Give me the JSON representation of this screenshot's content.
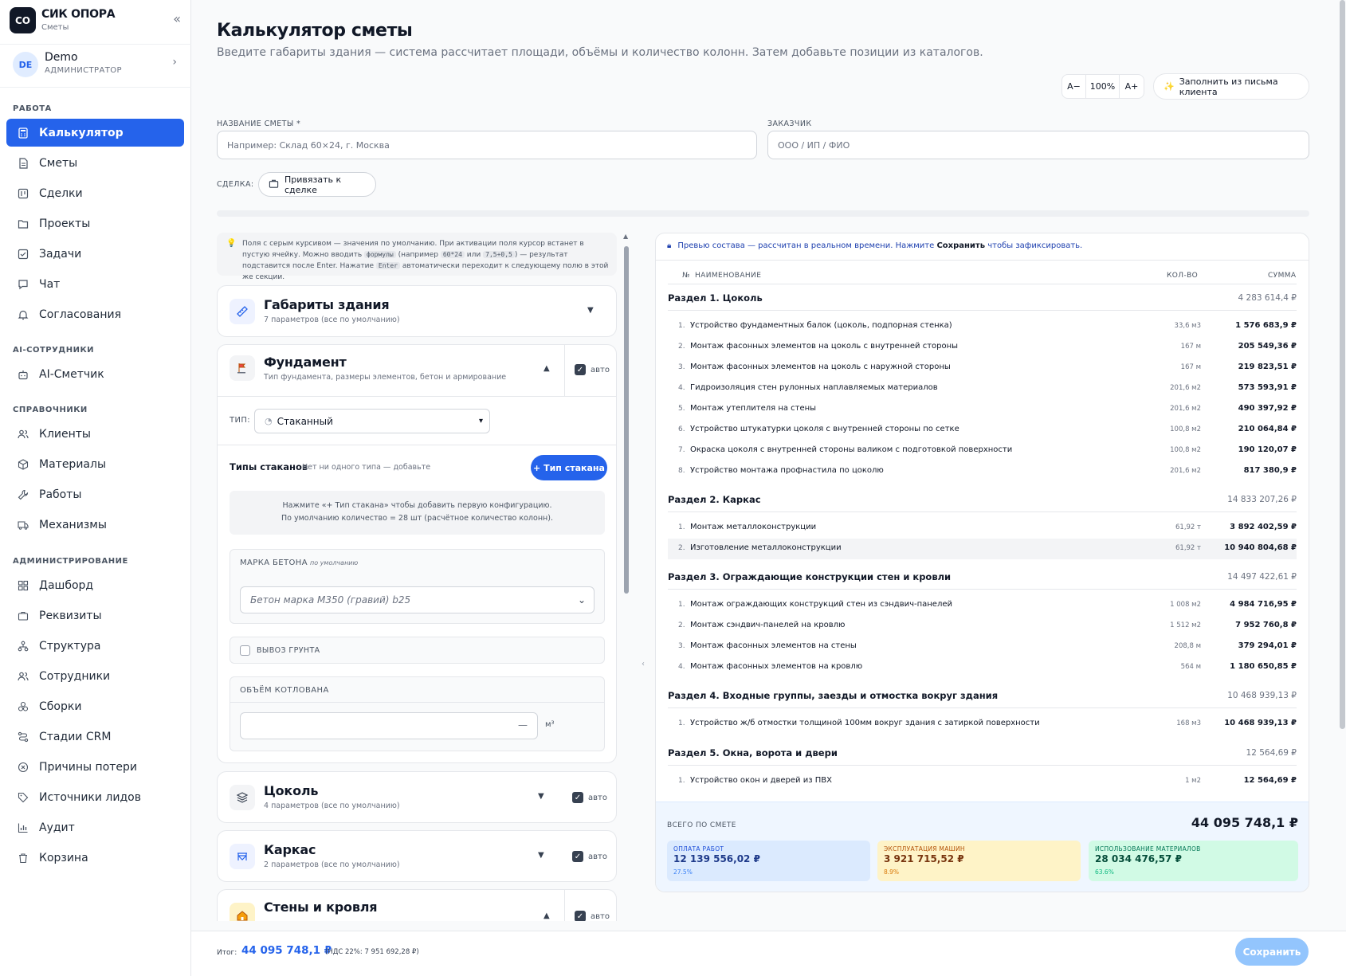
{
  "app": {
    "logo": "СО",
    "title": "СИК ОПОРА",
    "subtitle": "Сметы"
  },
  "user": {
    "initials": "DE",
    "name": "Demo",
    "role": "АДМИНИСТРАТОР"
  },
  "nav": {
    "sections": [
      "РАБОТА",
      "AI-СОТРУДНИКИ",
      "СПРАВОЧНИКИ",
      "АДМИНИСТРИРОВАНИЕ"
    ],
    "items": [
      "Калькулятор",
      "Сметы",
      "Сделки",
      "Проекты",
      "Задачи",
      "Чат",
      "Согласования",
      "AI-Сметчик",
      "Клиенты",
      "Материалы",
      "Работы",
      "Механизмы",
      "Дашборд",
      "Реквизиты",
      "Структура",
      "Сотрудники",
      "Сборки",
      "Стадии CRM",
      "Причины потери",
      "Источники лидов",
      "Аудит",
      "Корзина"
    ]
  },
  "page": {
    "title": "Калькулятор сметы",
    "subtitle": "Введите габариты здания — система рассчитает площади, объёмы и количество колонн. Затем добавьте позиции из каталогов."
  },
  "zoom": {
    "minus": "A−",
    "value": "100%",
    "plus": "A+"
  },
  "fill_button": "Заполнить из письма клиента",
  "form": {
    "name_label": "НАЗВАНИЕ СМЕТЫ *",
    "name_placeholder": "Например: Склад 60×24, г. Москва",
    "client_label": "ЗАКАЗЧИК",
    "client_placeholder": "ООО / ИП / ФИО",
    "deal_label": "СДЕЛКА:",
    "deal_button": "Привязать к сделке"
  },
  "hint": {
    "p1": "Поля с серым курсивом — значения по умолчанию. При активации поля курсор встанет в пустую ячейку. Можно вводить ",
    "code1": "формулы",
    "p2": " (например ",
    "code2": "60*24",
    "p3": " или ",
    "code3": "7,5+0,5",
    "p4": ") — результат подставится после Enter. Нажатие ",
    "code4": "Enter",
    "p5": " автоматически переходит к следующему полю в этой же секции."
  },
  "cards": {
    "dims": {
      "title": "Габариты здания",
      "sub": "7 параметров (все по умолчанию)"
    },
    "foundation": {
      "title": "Фундамент",
      "sub": "Тип фундамента, размеры элементов, бетон и армирование",
      "auto": "авто",
      "type_label": "ТИП:",
      "type_value": "Стаканный",
      "glass_title": "Типы стаканов",
      "glass_note": "Нет ни одного типа — добавьте",
      "add_glass": "+ Тип стакана",
      "empty1": "Нажмите «+ Тип стакана» чтобы добавить первую конфигурацию.",
      "empty2": "По умолчанию количество = 28 шт (расчётное количество колонн).",
      "concrete_label": "МАРКА БЕТОНА",
      "concrete_default": "по умолчанию",
      "concrete_value": "Бетон марка М350 (гравий) b25",
      "soil_label": "ВЫВОЗ ГРУНТА",
      "pit_label": "ОБЪЁМ КОТЛОВАНА",
      "pit_value": "—",
      "pit_unit": "м³"
    },
    "plinth": {
      "title": "Цоколь",
      "sub": "4 параметров (все по умолчанию)",
      "auto": "авто"
    },
    "frame": {
      "title": "Каркас",
      "sub": "2 параметров (все по умолчанию)",
      "auto": "авто"
    },
    "walls": {
      "title": "Стены и кровля",
      "auto": "авто"
    }
  },
  "preview": {
    "note_a": "Превью состава — рассчитан в реальном времени. Нажмите ",
    "note_b": "Сохранить",
    "note_c": " чтобы зафиксировать.",
    "col_num": "№",
    "col_name": "НАИМЕНОВАНИЕ",
    "col_qty": "КОЛ-ВО",
    "col_sum": "СУММА",
    "sections": [
      {
        "title": "Раздел 1. Цоколь",
        "sum": "4 283 614,4 ₽",
        "rows": [
          {
            "n": "1.",
            "name": "Устройство фундаментных балок (цоколь, подпорная стенка)",
            "qty": "33,6 м3",
            "sum": "1 576 683,9 ₽"
          },
          {
            "n": "2.",
            "name": "Монтаж фасонных элементов на цоколь с внутренней стороны",
            "qty": "167 м",
            "sum": "205 549,36 ₽"
          },
          {
            "n": "3.",
            "name": "Монтаж фасонных элементов на цоколь с наружной стороны",
            "qty": "167 м",
            "sum": "219 823,51 ₽"
          },
          {
            "n": "4.",
            "name": "Гидроизоляция стен рулонных наплавляемых материалов",
            "qty": "201,6 м2",
            "sum": "573 593,91 ₽"
          },
          {
            "n": "5.",
            "name": "Монтаж утеплителя на стены",
            "qty": "201,6 м2",
            "sum": "490 397,92 ₽"
          },
          {
            "n": "6.",
            "name": "Устройство штукатурки цоколя с внутренней стороны по сетке",
            "qty": "100,8 м2",
            "sum": "210 064,84 ₽"
          },
          {
            "n": "7.",
            "name": "Окраска цоколя с внутренней стороны валиком с подготовкой поверхности",
            "qty": "100,8 м2",
            "sum": "190 120,07 ₽"
          },
          {
            "n": "8.",
            "name": "Устройство монтажа профнастила по цоколю",
            "qty": "201,6 м2",
            "sum": "817 380,9 ₽"
          }
        ]
      },
      {
        "title": "Раздел 2. Каркас",
        "sum": "14 833 207,26 ₽",
        "rows": [
          {
            "n": "1.",
            "name": "Монтаж металлоконструкции",
            "qty": "61,92 т",
            "sum": "3 892 402,59 ₽"
          },
          {
            "n": "2.",
            "name": "Изготовление металлоконструкции",
            "qty": "61,92 т",
            "sum": "10 940 804,68 ₽"
          }
        ]
      },
      {
        "title": "Раздел 3. Ограждающие конструкции стен и кровли",
        "sum": "14 497 422,61 ₽",
        "rows": [
          {
            "n": "1.",
            "name": "Монтаж ограждающих конструкций стен из сэндвич-панелей",
            "qty": "1 008 м2",
            "sum": "4 984 716,95 ₽"
          },
          {
            "n": "2.",
            "name": "Монтаж сэндвич-панелей на кровлю",
            "qty": "1 512 м2",
            "sum": "7 952 760,8 ₽"
          },
          {
            "n": "3.",
            "name": "Монтаж фасонных элементов на стены",
            "qty": "208,8 м",
            "sum": "379 294,01 ₽"
          },
          {
            "n": "4.",
            "name": "Монтаж фасонных элементов на кровлю",
            "qty": "564 м",
            "sum": "1 180 650,85 ₽"
          }
        ]
      },
      {
        "title": "Раздел 4. Входные группы, заезды и отмостка вокруг здания",
        "sum": "10 468 939,13 ₽",
        "rows": [
          {
            "n": "1.",
            "name": "Устройство ж/б отмостки толщиной 100мм вокруг здания с затиркой поверхности",
            "qty": "168 м3",
            "sum": "10 468 939,13 ₽"
          }
        ]
      },
      {
        "title": "Раздел 5. Окна, ворота и двери",
        "sum": "12 564,69 ₽",
        "rows": [
          {
            "n": "1.",
            "name": "Устройство окон и дверей из ПВХ",
            "qty": "1 м2",
            "sum": "12 564,69 ₽"
          }
        ]
      }
    ],
    "total_label": "ВСЕГО ПО СМЕТЕ",
    "total": "44 095 748,1 ₽",
    "boxes": [
      {
        "label": "ОПЛАТА РАБОТ",
        "value": "12 139 556,02 ₽",
        "pct": "27.5%"
      },
      {
        "label": "ЭКСПЛУАТАЦИЯ МАШИН",
        "value": "3 921 715,52 ₽",
        "pct": "8.9%"
      },
      {
        "label": "ИСПОЛЬЗОВАНИЕ МАТЕРИАЛОВ",
        "value": "28 034 476,57 ₽",
        "pct": "63.6%"
      }
    ]
  },
  "footer": {
    "label": "Итог:",
    "total": "44 095 748,1 ₽",
    "vat": "(НДС 22%: 7 951 692,28 ₽)",
    "save": "Сохранить"
  },
  "colors": {
    "accent": "#2563eb",
    "box_work": "#dbeafe",
    "box_machines": "#fef3c7",
    "box_materials": "#d1fae5"
  }
}
